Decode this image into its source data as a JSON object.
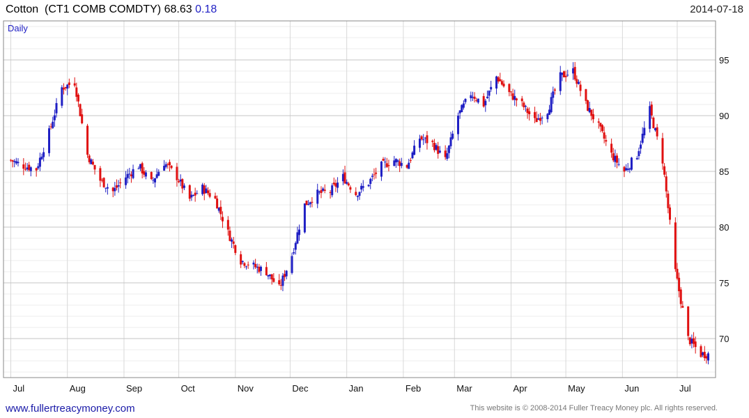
{
  "header": {
    "instrument": "Cotton",
    "symbol": "(CT1 COMB COMDTY)",
    "last": "68.63",
    "change": "0.18",
    "date": "2014-07-18"
  },
  "footer": {
    "website": "www.fullertreacymoney.com",
    "copyright": "This website is © 2008-2014 Fuller Treacy Money plc. All rights reserved."
  },
  "colors": {
    "up": "#1f1fc4",
    "down": "#e01010",
    "grid": "#d8d8d8",
    "frame": "#888888"
  },
  "chart_data": {
    "type": "candlestick",
    "period_label": "Daily",
    "ylim": [
      66.5,
      98.5
    ],
    "y_ticks": [
      70,
      75,
      80,
      85,
      90,
      95
    ],
    "x_ticks": [
      "Jul",
      "Aug",
      "Sep",
      "Oct",
      "Nov",
      "Dec",
      "Jan",
      "Feb",
      "Mar",
      "Apr",
      "May",
      "Jun",
      "Jul"
    ],
    "grid": true,
    "series": [
      {
        "x": [
          "2013-07-01",
          "2013-07-08",
          "2013-07-15",
          "2013-07-22",
          "2013-07-29",
          "2013-08-05",
          "2013-08-12",
          "2013-08-19",
          "2013-08-26",
          "2013-09-02",
          "2013-09-09",
          "2013-09-16",
          "2013-09-23",
          "2013-09-30",
          "2013-10-07",
          "2013-10-14",
          "2013-10-21",
          "2013-10-28",
          "2013-11-04",
          "2013-11-11",
          "2013-11-18",
          "2013-11-25",
          "2013-12-02",
          "2013-12-09",
          "2013-12-16",
          "2013-12-23",
          "2013-12-30",
          "2014-01-06",
          "2014-01-13",
          "2014-01-20",
          "2014-01-27",
          "2014-02-03",
          "2014-02-10",
          "2014-02-17",
          "2014-02-24",
          "2014-03-03",
          "2014-03-10",
          "2014-03-17",
          "2014-03-24",
          "2014-03-31",
          "2014-04-07",
          "2014-04-14",
          "2014-04-21",
          "2014-04-28",
          "2014-05-05",
          "2014-05-12",
          "2014-05-19",
          "2014-05-26",
          "2014-06-02",
          "2014-06-09",
          "2014-06-16",
          "2014-06-23",
          "2014-06-30",
          "2014-07-07",
          "2014-07-14"
        ],
        "close": [
          86.0,
          85.5,
          85.2,
          88.5,
          92.5,
          93.0,
          86.5,
          84.2,
          83.2,
          84.5,
          85.5,
          84.0,
          85.8,
          84.5,
          82.5,
          83.5,
          82.5,
          79.5,
          77.0,
          76.5,
          76.0,
          74.5,
          77.5,
          82.0,
          83.0,
          83.2,
          84.5,
          83.0,
          84.0,
          85.5,
          86.0,
          85.5,
          88.0,
          87.5,
          86.0,
          90.0,
          92.0,
          91.0,
          93.5,
          92.0,
          91.0,
          89.5,
          90.5,
          93.5,
          94.0,
          91.0,
          89.0,
          86.5,
          85.0,
          86.5,
          90.5,
          86.0,
          76.0,
          70.0,
          68.6
        ]
      }
    ]
  }
}
